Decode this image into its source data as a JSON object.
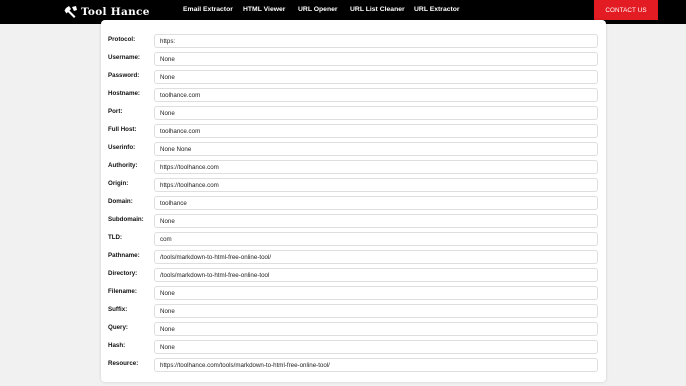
{
  "header": {
    "logo_text": "Tool Hance",
    "nav": [
      "Email Extractor",
      "HTML Viewer",
      "URL Opener",
      "URL List Cleaner",
      "URL Extractor"
    ],
    "contact_label": "CONTACT US"
  },
  "rows": [
    {
      "label": "Protocol:",
      "value": "https:"
    },
    {
      "label": "Username:",
      "value": "None"
    },
    {
      "label": "Password:",
      "value": "None"
    },
    {
      "label": "Hostname:",
      "value": "toolhance.com"
    },
    {
      "label": "Port:",
      "value": "None"
    },
    {
      "label": "Full Host:",
      "value": "toolhance.com"
    },
    {
      "label": "Userinfo:",
      "value": "None None"
    },
    {
      "label": "Authority:",
      "value": "https://toolhance.com"
    },
    {
      "label": "Origin:",
      "value": "https://toolhance.com"
    },
    {
      "label": "Domain:",
      "value": "toolhance"
    },
    {
      "label": "Subdomain:",
      "value": "None"
    },
    {
      "label": "TLD:",
      "value": "com"
    },
    {
      "label": "Pathname:",
      "value": "/tools/markdown-to-html-free-online-tool/"
    },
    {
      "label": "Directory:",
      "value": "/tools/markdown-to-html-free-online-tool"
    },
    {
      "label": "Filename:",
      "value": "None"
    },
    {
      "label": "Suffix:",
      "value": "None"
    },
    {
      "label": "Query:",
      "value": "None"
    },
    {
      "label": "Hash:",
      "value": "None"
    },
    {
      "label": "Resource:",
      "value": "https://toolhance.com/tools/markdown-to-html-free-online-tool/"
    }
  ]
}
